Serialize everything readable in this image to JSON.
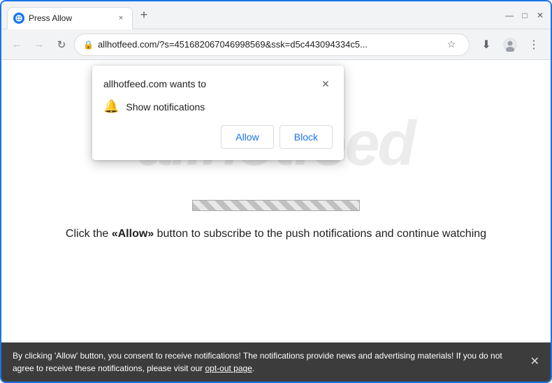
{
  "browser": {
    "title_bar": {
      "tab_title": "Press Allow",
      "tab_close_label": "×",
      "new_tab_label": "+",
      "win_minimize": "—",
      "win_maximize": "□",
      "win_close": "✕"
    },
    "address_bar": {
      "url": "allhotfeed.com/?s=451682067046998569&ssk=d5c443094334c5...",
      "back_icon": "←",
      "forward_icon": "→",
      "reload_icon": "↻",
      "lock_icon": "🔒",
      "star_icon": "☆",
      "account_icon": "⊙",
      "menu_icon": "⋮",
      "download_icon": "⬇"
    }
  },
  "notification_popup": {
    "title": "allhotfeed.com wants to",
    "close_label": "✕",
    "notification_text": "Show notifications",
    "bell_icon": "🔔",
    "allow_label": "Allow",
    "block_label": "Block"
  },
  "page": {
    "watermark_text": "allhotfeed",
    "cta_text": "Click the «Allow» button to subscribe to the push notifications and continue watching"
  },
  "banner": {
    "text": "By clicking 'Allow' button, you consent to receive notifications! The notifications provide news and advertising materials! If you do not agree to receive these notifications, please visit our ",
    "link_text": "opt-out page",
    "close_label": "✕"
  }
}
